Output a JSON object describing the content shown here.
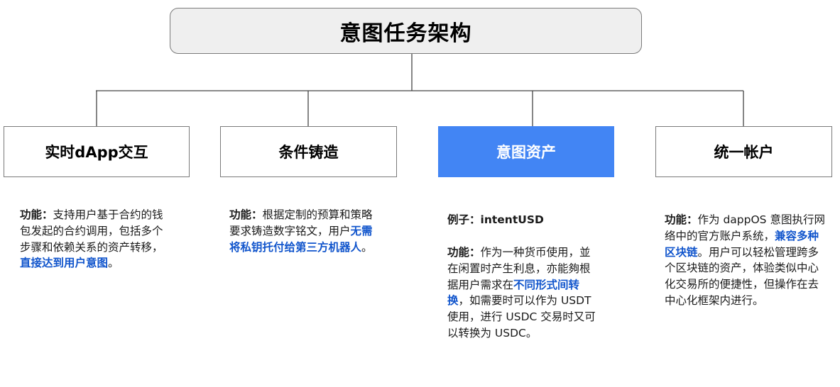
{
  "root": {
    "title": "意图任务架构"
  },
  "nodes": [
    {
      "title": "实时dApp交互",
      "highlight": false
    },
    {
      "title": "条件铸造",
      "highlight": false
    },
    {
      "title": "意图资产",
      "highlight": true
    },
    {
      "title": "统一帐户",
      "highlight": false
    }
  ],
  "descriptions": [
    {
      "label": "功能",
      "sep": "：",
      "text_before": "支持用户基于合约的钱包发起的合约调用，包括多个步骤和依赖关系的资产转移，",
      "highlight": "直接达到用户意图",
      "text_after": "。"
    },
    {
      "label": "功能",
      "sep": "：",
      "text_before": "根据定制的预算和策略要求铸造数字铭文，用户",
      "highlight": "无需将私钥托付给第三方机器人",
      "text_after": "。"
    },
    {
      "example_label": "例子：",
      "example_value": "intentUSD",
      "label": "功能",
      "sep": "：",
      "text_before": "作为一种货币使用，並在闲置时产生利息，亦能夠根据用户需求在",
      "highlight": "不同形式间转换",
      "text_after": "，如需要时可以作为 USDT 使用，进行 USDC 交易时又可以转换为 USDC。"
    },
    {
      "label": "功能",
      "sep": "：",
      "text_before": "作为 dappOS 意图执行网络中的官方账户系统，",
      "highlight": "兼容多种区块链",
      "text_after": "。用户可以轻松管理跨多个区块链的资产，体验类似中心化交易所的便捷性，但操作在去中心化框架内进行。"
    }
  ],
  "colors": {
    "highlight_node": "#4285f4",
    "highlight_text": "#1155cc",
    "root_fill": "#efefef",
    "border": "#7a7a7a"
  }
}
